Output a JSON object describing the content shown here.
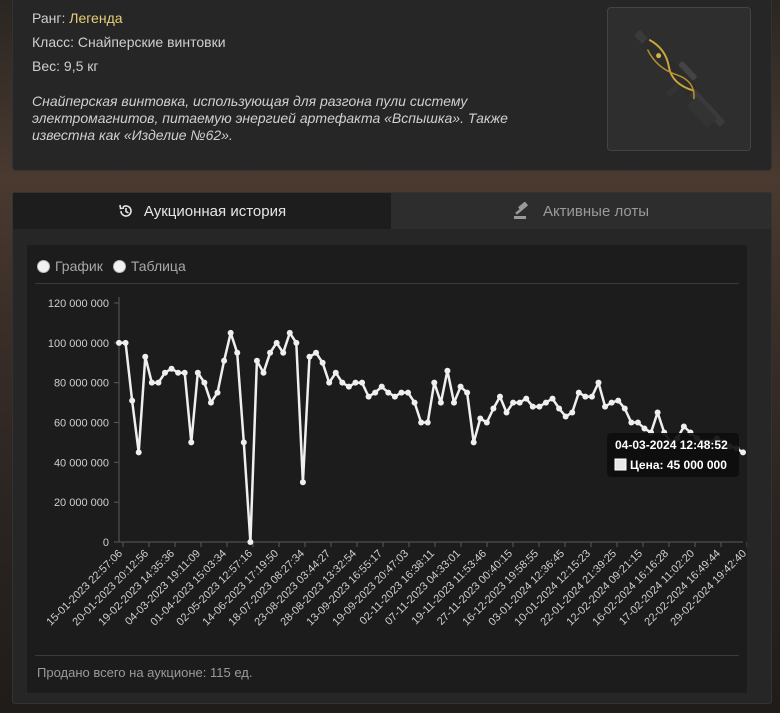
{
  "item": {
    "rank_label": "Ранг:",
    "rank_value": "Легенда",
    "class_text": "Класс: Снайперские винтовки",
    "weight_text": "Вес: 9,5 кг",
    "description": "Снайперская винтовка, использующая для разгона пули систему электромагнитов, питаемую энергией артефакта «Вспышка». Также известна как «Изделие №62».",
    "rank_color": "#e8cf76"
  },
  "tabs": [
    {
      "label": "Аукционная история",
      "icon": "history-icon",
      "active": true
    },
    {
      "label": "Активные лоты",
      "icon": "gavel-icon",
      "active": false
    }
  ],
  "view_options": [
    {
      "label": "График",
      "selected": false
    },
    {
      "label": "Таблица",
      "selected": false
    }
  ],
  "tooltip": {
    "date": "04-03-2024 12:48:52",
    "price": "Цена: 45 000 000"
  },
  "footer": {
    "sold_text": "Продано всего на аукционе: 115 ед."
  },
  "chart_data": {
    "type": "line",
    "yticks": [
      "120 000 000",
      "100 000 000",
      "80 000 000",
      "60 000 000",
      "40 000 000",
      "20 000 000",
      "0"
    ],
    "ylim": [
      0,
      120000000
    ],
    "xticks": [
      "15-01-2023 22:57:06",
      "20-01-2023 20:12:56",
      "19-02-2023 14:35:36",
      "04-03-2023 19:11:09",
      "01-04-2023 15:03:34",
      "02-05-2023 12:57:16",
      "14-06-2023 17:19:50",
      "18-07-2023 08:27:34",
      "23-08-2023 03:44:27",
      "28-08-2023 13:32:54",
      "13-09-2023 16:55:17",
      "19-09-2023 20:47:03",
      "02-11-2023 16:38:11",
      "07-11-2023 04:33:01",
      "19-11-2023 11:53:46",
      "27-11-2023 00:40:15",
      "16-12-2023 19:58:55",
      "03-01-2024 12:36:45",
      "10-01-2024 12:15:23",
      "22-01-2024 21:39:25",
      "12-02-2024 09:21:15",
      "16-02-2024 16:16:28",
      "17-02-2024 11:02:20",
      "22-02-2024 16:49:44",
      "29-02-2024 19:42:40"
    ],
    "values": [
      100000000,
      100000000,
      71000000,
      45000000,
      93000000,
      80000000,
      80000000,
      85000000,
      87000000,
      85000000,
      85000000,
      50000000,
      85000000,
      80000000,
      70000000,
      75000000,
      91000000,
      105000000,
      95000000,
      50000000,
      0,
      91000000,
      85000000,
      95000000,
      100000000,
      95000000,
      105000000,
      100000000,
      30000000,
      93000000,
      95000000,
      90000000,
      80000000,
      85000000,
      80000000,
      78000000,
      80000000,
      80000000,
      73000000,
      75000000,
      78000000,
      75000000,
      73000000,
      75000000,
      75000000,
      70000000,
      60000000,
      60000000,
      80000000,
      70000000,
      86000000,
      70000000,
      78000000,
      75000000,
      50000000,
      62000000,
      60000000,
      67000000,
      73000000,
      65000000,
      70000000,
      70000000,
      72000000,
      68000000,
      68000000,
      70000000,
      72000000,
      67000000,
      63000000,
      65000000,
      75000000,
      73000000,
      73000000,
      80000000,
      68000000,
      70000000,
      71000000,
      67000000,
      60000000,
      60000000,
      57000000,
      55000000,
      65000000,
      55000000,
      50000000,
      52000000,
      58000000,
      55000000,
      52000000,
      50000000,
      50000000,
      52000000,
      50000000,
      48000000,
      47000000,
      45000000
    ],
    "line_color": "#efefef",
    "grid": false
  }
}
